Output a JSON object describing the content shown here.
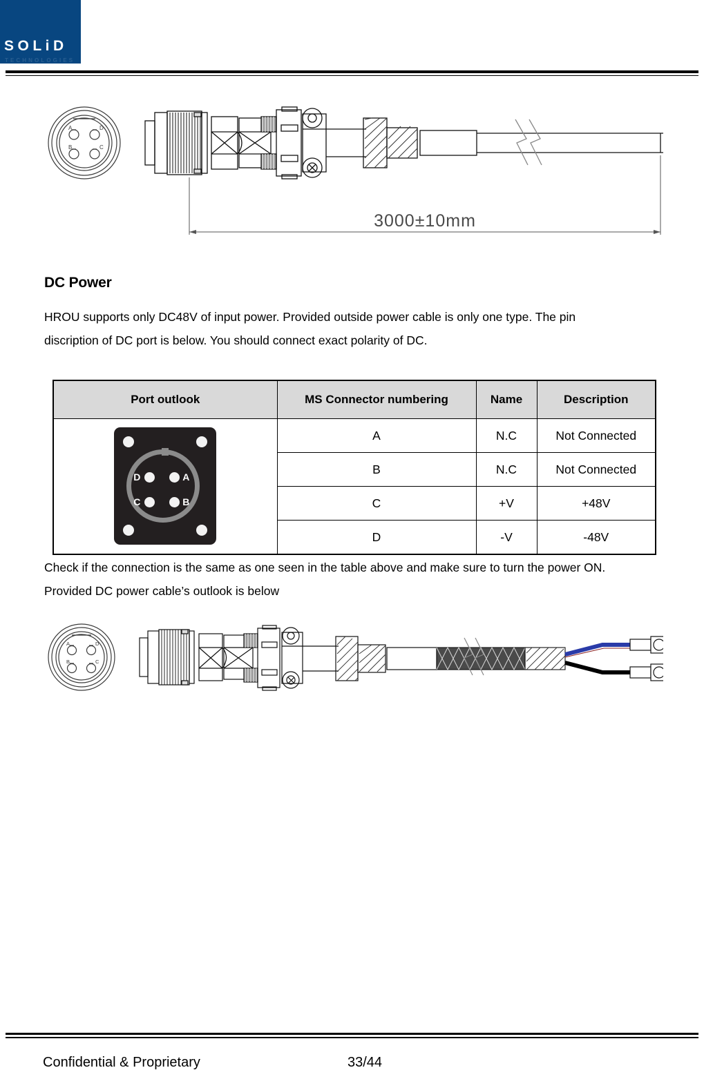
{
  "brand": {
    "logo_text": "SOLiD",
    "logo_sub": "TECHNOLOGIES",
    "logo_color": "#084680"
  },
  "figure_top": {
    "name": "power-cable-drawing",
    "dimension_label": "3000±10mm",
    "connector_pins": [
      "A",
      "D",
      "B",
      "C"
    ]
  },
  "section": {
    "heading": "DC Power",
    "paragraph_line1": "HROU supports only DC48V of input power. Provided outside power cable is only one type. The pin",
    "paragraph_line2": "discription of DC port is below. You should connect exact polarity of DC."
  },
  "table": {
    "headers": [
      "Port outlook",
      "MS Connector numbering",
      "Name",
      "Description"
    ],
    "port_outlook": {
      "pin_labels": {
        "top_left": "D",
        "top_right": "A",
        "bottom_left": "C",
        "bottom_right": "B"
      }
    },
    "rows": [
      {
        "numbering": "A",
        "name": "N.C",
        "description": "Not Connected"
      },
      {
        "numbering": "B",
        "name": "N.C",
        "description": "Not Connected"
      },
      {
        "numbering": "C",
        "name": "+V",
        "description": "+48V"
      },
      {
        "numbering": "D",
        "name": "-V",
        "description": "-48V"
      }
    ]
  },
  "after_table": {
    "line1": "Check if the connection is the same as one seen in the table above and make sure to turn the power ON.",
    "line2": "Provided DC power cable’s outlook is below"
  },
  "figure_bottom": {
    "name": "dc-power-cable-drawing",
    "connector_pins": [
      "A",
      "D",
      "B",
      "C"
    ],
    "wire_colors": {
      "positive": "#2a3ba8",
      "negative": "#000000"
    }
  },
  "footer": {
    "confidential": "Confidential & Proprietary",
    "page": "33/44"
  }
}
